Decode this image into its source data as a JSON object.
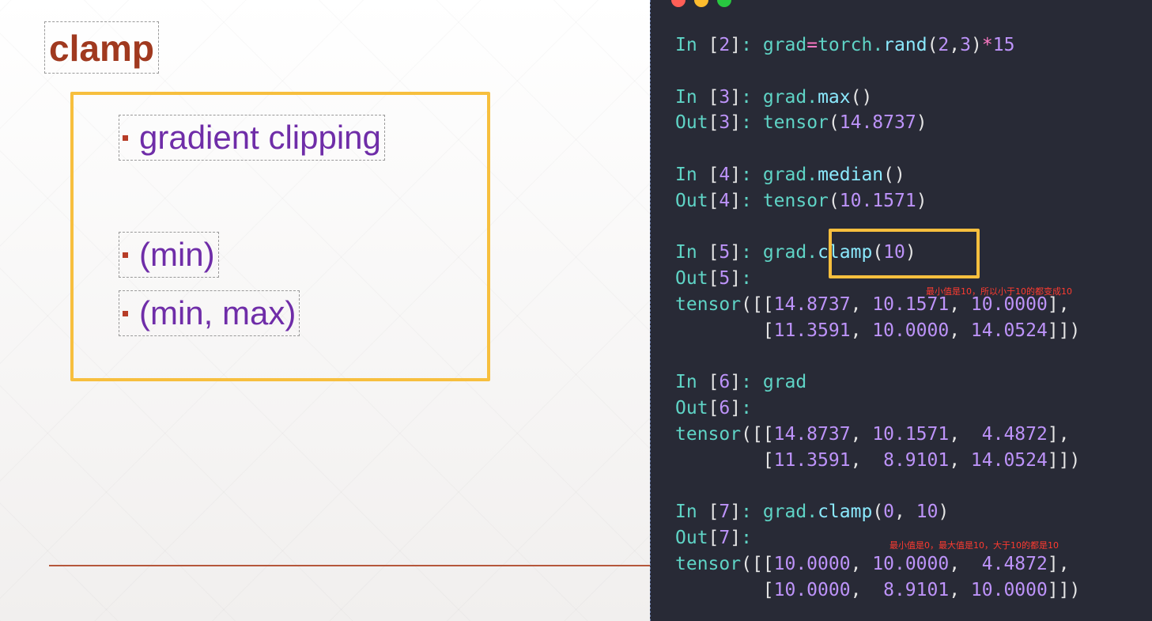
{
  "slide": {
    "title": "clamp",
    "bullets": [
      "gradient clipping",
      "(min)",
      "(min, max)"
    ]
  },
  "terminal": {
    "window_controls": [
      "close",
      "minimize",
      "maximize"
    ],
    "lines": [
      [
        [
          "pr",
          "In "
        ],
        [
          "pl",
          "["
        ],
        [
          "num",
          "2"
        ],
        [
          "pl",
          "]"
        ],
        [
          "pr",
          ": grad"
        ],
        [
          "op",
          "="
        ],
        [
          "pr",
          "torch."
        ],
        [
          "fn",
          "rand"
        ],
        [
          "pl",
          "("
        ],
        [
          "num",
          "2"
        ],
        [
          "pl",
          ","
        ],
        [
          "num",
          "3"
        ],
        [
          "pl",
          ")"
        ],
        [
          "op",
          "*"
        ],
        [
          "num",
          "15"
        ]
      ],
      [],
      [
        [
          "pr",
          "In "
        ],
        [
          "pl",
          "["
        ],
        [
          "num",
          "3"
        ],
        [
          "pl",
          "]"
        ],
        [
          "pr",
          ": grad."
        ],
        [
          "fn",
          "max"
        ],
        [
          "pl",
          "()"
        ]
      ],
      [
        [
          "pr",
          "Out"
        ],
        [
          "pl",
          "["
        ],
        [
          "num",
          "3"
        ],
        [
          "pl",
          "]"
        ],
        [
          "pr",
          ": tensor"
        ],
        [
          "pl",
          "("
        ],
        [
          "num",
          "14.8737"
        ],
        [
          "pl",
          ")"
        ]
      ],
      [],
      [
        [
          "pr",
          "In "
        ],
        [
          "pl",
          "["
        ],
        [
          "num",
          "4"
        ],
        [
          "pl",
          "]"
        ],
        [
          "pr",
          ": grad."
        ],
        [
          "fn",
          "median"
        ],
        [
          "pl",
          "()"
        ]
      ],
      [
        [
          "pr",
          "Out"
        ],
        [
          "pl",
          "["
        ],
        [
          "num",
          "4"
        ],
        [
          "pl",
          "]"
        ],
        [
          "pr",
          ": tensor"
        ],
        [
          "pl",
          "("
        ],
        [
          "num",
          "10.1571"
        ],
        [
          "pl",
          ")"
        ]
      ],
      [],
      [
        [
          "pr",
          "In "
        ],
        [
          "pl",
          "["
        ],
        [
          "num",
          "5"
        ],
        [
          "pl",
          "]"
        ],
        [
          "pr",
          ": grad."
        ],
        [
          "fn",
          "clamp"
        ],
        [
          "pl",
          "("
        ],
        [
          "num",
          "10"
        ],
        [
          "pl",
          ")"
        ]
      ],
      [
        [
          "pr",
          "Out"
        ],
        [
          "pl",
          "["
        ],
        [
          "num",
          "5"
        ],
        [
          "pl",
          "]"
        ],
        [
          "pr",
          ":"
        ]
      ],
      [
        [
          "pr",
          "tensor"
        ],
        [
          "pl",
          "([["
        ],
        [
          "num",
          "14.8737"
        ],
        [
          "pl",
          ", "
        ],
        [
          "num",
          "10.1571"
        ],
        [
          "pl",
          ", "
        ],
        [
          "num",
          "10.0000"
        ],
        [
          "pl",
          "],"
        ]
      ],
      [
        [
          "pl",
          "        ["
        ],
        [
          "num",
          "11.3591"
        ],
        [
          "pl",
          ", "
        ],
        [
          "num",
          "10.0000"
        ],
        [
          "pl",
          ", "
        ],
        [
          "num",
          "14.0524"
        ],
        [
          "pl",
          "]])"
        ]
      ],
      [],
      [
        [
          "pr",
          "In "
        ],
        [
          "pl",
          "["
        ],
        [
          "num",
          "6"
        ],
        [
          "pl",
          "]"
        ],
        [
          "pr",
          ": grad"
        ]
      ],
      [
        [
          "pr",
          "Out"
        ],
        [
          "pl",
          "["
        ],
        [
          "num",
          "6"
        ],
        [
          "pl",
          "]"
        ],
        [
          "pr",
          ":"
        ]
      ],
      [
        [
          "pr",
          "tensor"
        ],
        [
          "pl",
          "([["
        ],
        [
          "num",
          "14.8737"
        ],
        [
          "pl",
          ", "
        ],
        [
          "num",
          "10.1571"
        ],
        [
          "pl",
          ",  "
        ],
        [
          "num",
          "4.4872"
        ],
        [
          "pl",
          "],"
        ]
      ],
      [
        [
          "pl",
          "        ["
        ],
        [
          "num",
          "11.3591"
        ],
        [
          "pl",
          ",  "
        ],
        [
          "num",
          "8.9101"
        ],
        [
          "pl",
          ", "
        ],
        [
          "num",
          "14.0524"
        ],
        [
          "pl",
          "]])"
        ]
      ],
      [],
      [
        [
          "pr",
          "In "
        ],
        [
          "pl",
          "["
        ],
        [
          "num",
          "7"
        ],
        [
          "pl",
          "]"
        ],
        [
          "pr",
          ": grad."
        ],
        [
          "fn",
          "clamp"
        ],
        [
          "pl",
          "("
        ],
        [
          "num",
          "0"
        ],
        [
          "pl",
          ", "
        ],
        [
          "num",
          "10"
        ],
        [
          "pl",
          ")"
        ]
      ],
      [
        [
          "pr",
          "Out"
        ],
        [
          "pl",
          "["
        ],
        [
          "num",
          "7"
        ],
        [
          "pl",
          "]"
        ],
        [
          "pr",
          ":"
        ]
      ],
      [
        [
          "pr",
          "tensor"
        ],
        [
          "pl",
          "([["
        ],
        [
          "num",
          "10.0000"
        ],
        [
          "pl",
          ", "
        ],
        [
          "num",
          "10.0000"
        ],
        [
          "pl",
          ",  "
        ],
        [
          "num",
          "4.4872"
        ],
        [
          "pl",
          "],"
        ]
      ],
      [
        [
          "pl",
          "        ["
        ],
        [
          "num",
          "10.0000"
        ],
        [
          "pl",
          ",  "
        ],
        [
          "num",
          "8.9101"
        ],
        [
          "pl",
          ", "
        ],
        [
          "num",
          "10.0000"
        ],
        [
          "pl",
          "]])"
        ]
      ]
    ],
    "annotations": {
      "clamp_min": "最小值是10，所以小于10的都变成10",
      "clamp_min_max": "最小值是0，最大值是10，大于10的都是10"
    },
    "colors": {
      "background": "#282a36",
      "prompt": "#5fd4c6",
      "number": "#bd93f9",
      "function": "#8be9fd",
      "operator": "#ff79c6",
      "highlight_box": "#f7bf3e",
      "annotation": "#ff3b30"
    }
  }
}
